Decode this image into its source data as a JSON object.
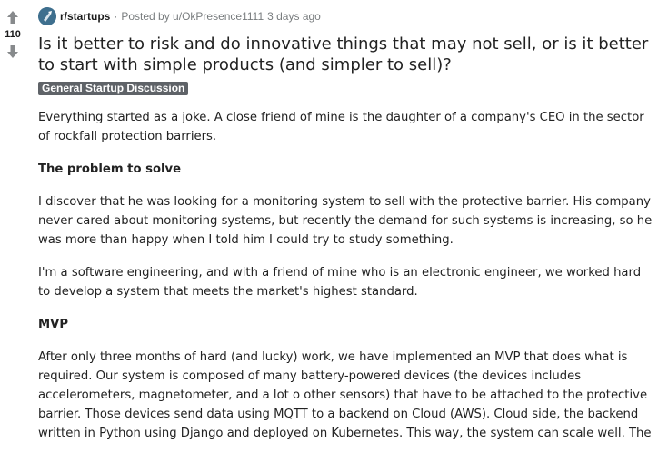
{
  "vote": {
    "count": "110",
    "upvote_icon": "arrow-up-icon",
    "downvote_icon": "arrow-down-icon"
  },
  "meta": {
    "subreddit": "r/startups",
    "separator": "·",
    "posted_by": "Posted by u/OkPresence1111",
    "time": "3 days ago"
  },
  "post": {
    "title": "Is it better to risk and do innovative things that may not sell, or is it better to start with simple products (and simpler to sell)?",
    "flair": "General Startup Discussion",
    "p1": "Everything started as a joke. A close friend of mine is the daughter of a company's CEO in the sector of rockfall protection barriers.",
    "h1": "The problem to solve",
    "p2": "I discover that he was looking for a monitoring system to sell with the protective barrier. His company never cared about monitoring systems, but recently the demand for such systems is increasing, so he was more than happy when I told him I could try to study something.",
    "p3": "I'm a software engineering, and with a friend of mine who is an electronic engineer, we worked hard to develop a system that meets the market's highest standard.",
    "h2": "MVP",
    "p4": "After only three months of hard (and lucky) work, we have implemented an MVP that does what is required. Our system is composed of many battery-powered devices (the devices includes accelerometers, magnetometer, and a lot o other sensors) that have to be attached to the protective barrier. Those devices send data using MQTT to a backend on Cloud (AWS). Cloud side, the backend written in Python using Django and deployed on Kubernetes. This way, the system can scale well. The"
  },
  "colors": {
    "vote_arrow": "#878a8c",
    "flair_bg": "#5f6368",
    "meta_text": "#787c7e",
    "body_text": "#222222"
  }
}
